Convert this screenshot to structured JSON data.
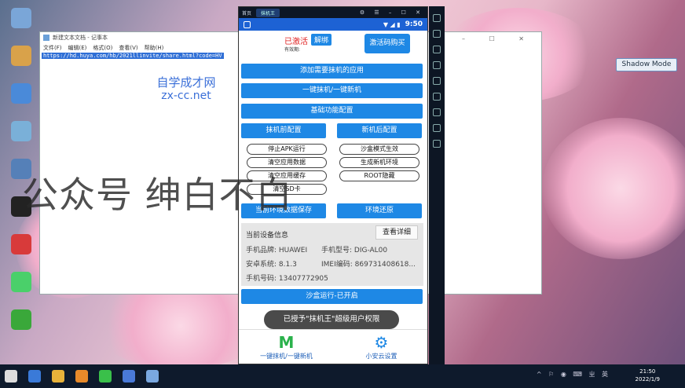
{
  "desktop": {
    "icons": [
      {
        "label": "",
        "color": "#7aa6d8"
      },
      {
        "label": "",
        "color": "#d9a24a"
      },
      {
        "label": "",
        "color": "#4a8ad9"
      },
      {
        "label": "",
        "color": "#7ab0d8"
      },
      {
        "label": "",
        "color": "#5580b8"
      },
      {
        "label": "",
        "color": "#222222"
      },
      {
        "label": "",
        "color": "#d83a3a"
      },
      {
        "label": "",
        "color": "#4ad06a"
      },
      {
        "label": "",
        "color": "#3aa83a"
      }
    ],
    "shadow_mode_label": "Shadow Mode",
    "overlay_text": "公众号 绅白不白"
  },
  "notepad": {
    "title": "新建文本文档 - 记事本",
    "menu": [
      "文件(F)",
      "编辑(E)",
      "格式(O)",
      "查看(V)",
      "帮助(H)"
    ],
    "url_text": "https://hd.huya.com/hb/2021llinvite/share.html?code=HV",
    "watermark_line1": "自学成才网",
    "watermark_line2": "zx-cc.net"
  },
  "emulator": {
    "top_tab_home": "首页",
    "top_tab_active": "抹机王",
    "status_time": "9:50",
    "activation_status": "已激活",
    "expiry_label": "有效期:",
    "unbind_label": "解绑",
    "buy_label": "激活码购买",
    "buttons": {
      "add_apps": "添加需要抹机的应用",
      "one_key": "一键抹机/一键新机",
      "basic_config": "基础功能配置",
      "pre_config": "抹机前配置",
      "post_config": "新机后配置",
      "current_env": "当前环境数据保存",
      "restore_env": "环境还原",
      "sandbox_running": "沙盒运行-已开启"
    },
    "pills": {
      "stop_apk": "停止APK运行",
      "sandbox_mode": "沙盒模式生效",
      "clear_data": "清空应用数据",
      "gen_env": "生成新机环境",
      "clear_cache": "清空应用缓存",
      "root_hide": "ROOT隐藏",
      "clear_sd": "清空SD卡"
    },
    "device_info": {
      "title": "当前设备信息",
      "detail_button": "查看详细",
      "brand": "手机品牌: HUAWEI",
      "model": "手机型号: DIG-AL00",
      "android": "安卓系统: 8.1.3",
      "imei": "IMEI编码: 869731408618...",
      "phone": "手机号码: 13407772905"
    },
    "toast": "已授予\"抹机王\"超级用户权限",
    "nav": [
      {
        "glyph": "M",
        "label": "一键抹机/一键新机"
      },
      {
        "glyph": "⚙",
        "label": "小安云设置"
      }
    ]
  },
  "taskbar": {
    "time": "21:50",
    "date": "2022/1/9",
    "tray_text": "^ ⚐ ◉ ⌨ ㄓ 英"
  }
}
